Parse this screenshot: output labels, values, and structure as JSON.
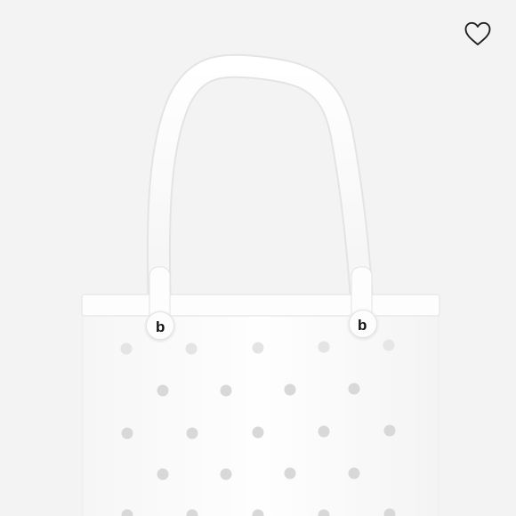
{
  "product": {
    "name": "",
    "color": "white",
    "logo_letter": "b"
  },
  "favorite": {
    "icon": "heart-outline-icon",
    "selected": false
  },
  "colors": {
    "background": "#f3f3f3",
    "bag": "#fcfcfc",
    "hole": "#d9d9d9",
    "icon_stroke": "#222222"
  }
}
